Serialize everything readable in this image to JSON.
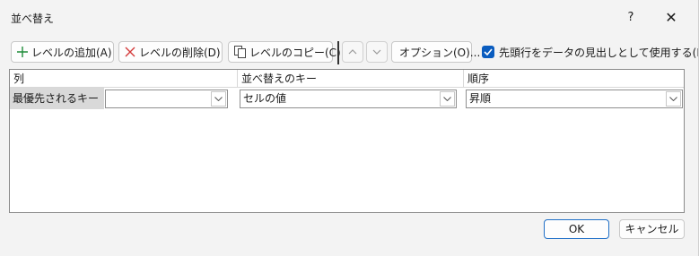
{
  "window": {
    "title": "並べ替え",
    "help": "?",
    "close": "✕"
  },
  "toolbar": {
    "add_level": "レベルの追加(A)",
    "delete_level": "レベルの削除(D)",
    "copy_level": "レベルのコピー(C)",
    "options": "オプション(O)...",
    "header_checkbox_label": "先頭行をデータの見出しとして使用する(H)",
    "header_checked": true
  },
  "grid": {
    "headers": {
      "column": "列",
      "sort_on": "並べ替えのキー",
      "order": "順序"
    },
    "rows": [
      {
        "label": "最優先されるキー",
        "column": "",
        "sort_on": "セルの値",
        "order": "昇順"
      }
    ]
  },
  "buttons": {
    "ok": "OK",
    "cancel": "キャンセル"
  },
  "colors": {
    "accent": "#0a5cbf",
    "add_icon": "#1e8c3a",
    "delete_icon": "#d43a3a"
  }
}
